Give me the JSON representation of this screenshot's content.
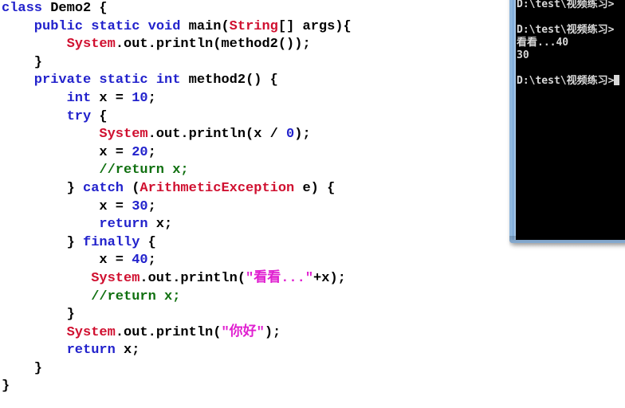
{
  "editor": {
    "name": "code-editor",
    "language": "java",
    "colors": {
      "keyword": "#2222cc",
      "class_name": "#d01030",
      "string": "#e020d0",
      "comment": "#107010",
      "plain": "#000000",
      "background": "#ffffff"
    },
    "lines": [
      {
        "indent": 0,
        "tokens": [
          {
            "t": "class",
            "c": "kw"
          },
          {
            "t": " ",
            "c": "plain"
          },
          {
            "t": "Demo2",
            "c": "plain"
          },
          {
            "t": " {",
            "c": "plain"
          }
        ]
      },
      {
        "indent": 4,
        "tokens": [
          {
            "t": "public",
            "c": "kw"
          },
          {
            "t": " ",
            "c": "plain"
          },
          {
            "t": "static",
            "c": "kw"
          },
          {
            "t": " ",
            "c": "plain"
          },
          {
            "t": "void",
            "c": "kw"
          },
          {
            "t": " ",
            "c": "plain"
          },
          {
            "t": "main(",
            "c": "plain"
          },
          {
            "t": "String",
            "c": "cls"
          },
          {
            "t": "[] args){",
            "c": "plain"
          }
        ]
      },
      {
        "indent": 8,
        "tokens": [
          {
            "t": "System",
            "c": "cls"
          },
          {
            "t": ".out.println(method2());",
            "c": "plain"
          }
        ]
      },
      {
        "indent": 4,
        "tokens": [
          {
            "t": "}",
            "c": "plain"
          }
        ]
      },
      {
        "indent": 4,
        "tokens": [
          {
            "t": "private",
            "c": "kw"
          },
          {
            "t": " ",
            "c": "plain"
          },
          {
            "t": "static",
            "c": "kw"
          },
          {
            "t": " ",
            "c": "plain"
          },
          {
            "t": "int",
            "c": "kw"
          },
          {
            "t": " ",
            "c": "plain"
          },
          {
            "t": "method2() {",
            "c": "plain"
          }
        ]
      },
      {
        "indent": 8,
        "tokens": [
          {
            "t": "int",
            "c": "kw"
          },
          {
            "t": " ",
            "c": "plain"
          },
          {
            "t": "x = ",
            "c": "plain"
          },
          {
            "t": "10",
            "c": "kw"
          },
          {
            "t": ";",
            "c": "plain"
          }
        ]
      },
      {
        "indent": 8,
        "tokens": [
          {
            "t": "try",
            "c": "kw"
          },
          {
            "t": " {",
            "c": "plain"
          }
        ]
      },
      {
        "indent": 12,
        "tokens": [
          {
            "t": "System",
            "c": "cls"
          },
          {
            "t": ".out.println(x / ",
            "c": "plain"
          },
          {
            "t": "0",
            "c": "kw"
          },
          {
            "t": ");",
            "c": "plain"
          }
        ]
      },
      {
        "indent": 12,
        "tokens": [
          {
            "t": "x = ",
            "c": "plain"
          },
          {
            "t": "20",
            "c": "kw"
          },
          {
            "t": ";",
            "c": "plain"
          }
        ]
      },
      {
        "indent": 12,
        "tokens": [
          {
            "t": "//return x;",
            "c": "cmt"
          }
        ]
      },
      {
        "indent": 8,
        "tokens": [
          {
            "t": "} ",
            "c": "plain"
          },
          {
            "t": "catch",
            "c": "kw"
          },
          {
            "t": " (",
            "c": "plain"
          },
          {
            "t": "ArithmeticException",
            "c": "cls"
          },
          {
            "t": " e) {",
            "c": "plain"
          }
        ]
      },
      {
        "indent": 12,
        "tokens": [
          {
            "t": "x = ",
            "c": "plain"
          },
          {
            "t": "30",
            "c": "kw"
          },
          {
            "t": ";",
            "c": "plain"
          }
        ]
      },
      {
        "indent": 12,
        "tokens": [
          {
            "t": "return",
            "c": "kw"
          },
          {
            "t": " x;",
            "c": "plain"
          }
        ]
      },
      {
        "indent": 8,
        "tokens": [
          {
            "t": "} ",
            "c": "plain"
          },
          {
            "t": "finally",
            "c": "kw"
          },
          {
            "t": " {",
            "c": "plain"
          }
        ]
      },
      {
        "indent": 12,
        "tokens": [
          {
            "t": "x = ",
            "c": "plain"
          },
          {
            "t": "40",
            "c": "kw"
          },
          {
            "t": ";",
            "c": "plain"
          }
        ]
      },
      {
        "indent": 11,
        "tokens": [
          {
            "t": "System",
            "c": "cls"
          },
          {
            "t": ".out.println(",
            "c": "plain"
          },
          {
            "t": "\"看看...\"",
            "c": "str"
          },
          {
            "t": "+x);",
            "c": "plain"
          }
        ]
      },
      {
        "indent": 11,
        "tokens": [
          {
            "t": "//return x;",
            "c": "cmt"
          }
        ]
      },
      {
        "indent": 8,
        "tokens": [
          {
            "t": "}",
            "c": "plain"
          }
        ]
      },
      {
        "indent": 8,
        "tokens": [
          {
            "t": "System",
            "c": "cls"
          },
          {
            "t": ".out.println(",
            "c": "plain"
          },
          {
            "t": "\"你好\"",
            "c": "str"
          },
          {
            "t": ");",
            "c": "plain"
          }
        ]
      },
      {
        "indent": 8,
        "tokens": [
          {
            "t": "return",
            "c": "kw"
          },
          {
            "t": " x;",
            "c": "plain"
          }
        ]
      },
      {
        "indent": 4,
        "tokens": [
          {
            "t": "}",
            "c": "plain"
          }
        ]
      },
      {
        "indent": 0,
        "tokens": [
          {
            "t": "}",
            "c": "plain"
          }
        ]
      }
    ]
  },
  "console": {
    "name": "command-prompt",
    "background": "#000000",
    "foreground": "#d8d8d8",
    "lines": [
      {
        "text": "D:\\test\\视频练习>",
        "type": "prompt"
      },
      {
        "text": "",
        "type": "blank"
      },
      {
        "text": "D:\\test\\视频练习>",
        "type": "prompt"
      },
      {
        "text": "看看...40",
        "type": "output"
      },
      {
        "text": "30",
        "type": "output"
      },
      {
        "text": "",
        "type": "blank"
      },
      {
        "text": "D:\\test\\视频练习>",
        "type": "prompt"
      }
    ]
  }
}
